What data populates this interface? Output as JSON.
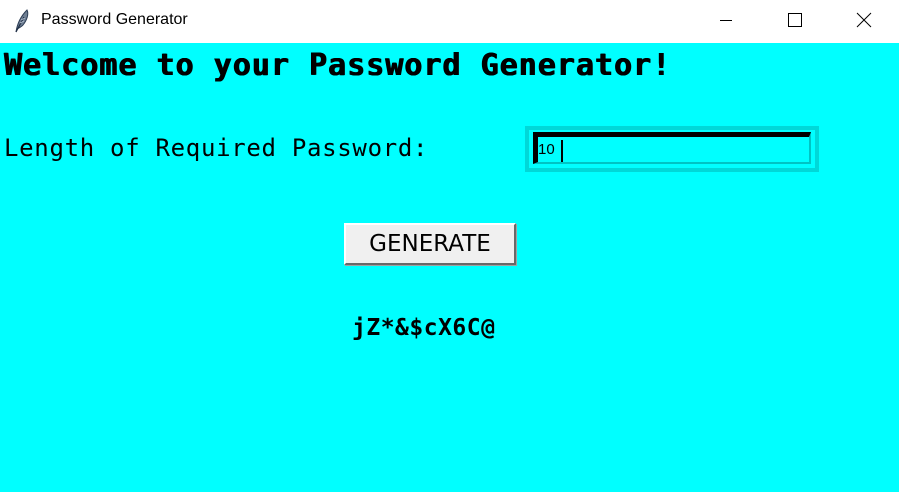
{
  "window": {
    "title": "Password Generator",
    "icon": "feather-icon",
    "controls": {
      "minimize_icon": "minimize-icon",
      "maximize_icon": "maximize-icon",
      "close_icon": "close-icon"
    }
  },
  "main": {
    "heading": "Welcome to your Password Generator!",
    "length_label": "Length of Required Password:",
    "length_value": "10",
    "generate_label": "GENERATE",
    "generated_password": "jZ*&$cX6C@"
  },
  "colors": {
    "background": "#00ffff",
    "titlebar": "#ffffff",
    "text": "#000000",
    "button": "#f0f0f0"
  }
}
